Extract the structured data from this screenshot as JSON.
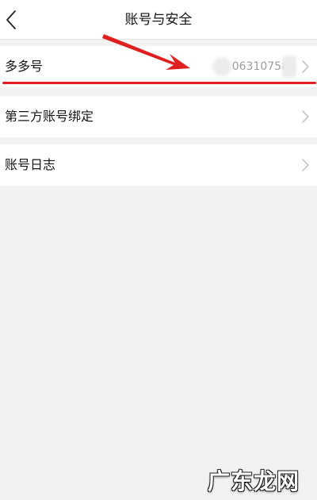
{
  "header": {
    "title": "账号与安全"
  },
  "rows": [
    {
      "label": "多多号",
      "value": "06310758"
    },
    {
      "label": "第三方账号绑定"
    },
    {
      "label": "账号日志"
    }
  ],
  "icons": {
    "back": "chevron-left-icon",
    "row_arrow": "chevron-right-icon"
  },
  "annotation": {
    "color": "#e02020"
  },
  "watermark": {
    "text": "广东龙网"
  }
}
